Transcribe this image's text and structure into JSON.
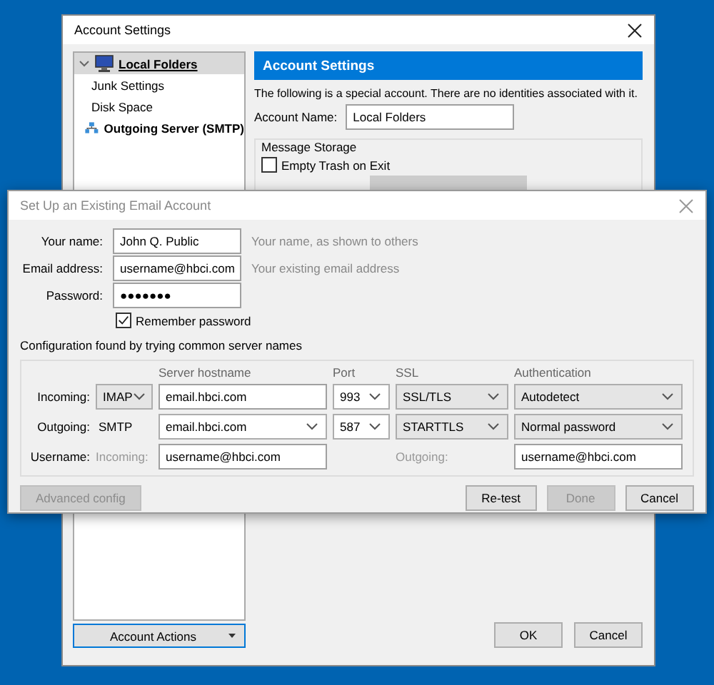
{
  "account_settings_window": {
    "title": "Account Settings",
    "tree": [
      {
        "label": "Local Folders",
        "selected": true,
        "expanded": true,
        "children": [
          {
            "label": "Junk Settings",
            "selected": false
          },
          {
            "label": "Disk Space",
            "selected": false
          }
        ]
      },
      {
        "label": "Outgoing Server (SMTP)",
        "selected": false
      }
    ],
    "account_actions_button": "Account Actions",
    "panel": {
      "header": "Account Settings",
      "description": "The following is a special account. There are no identities associated with it.",
      "account_name": {
        "label": "Account Name:",
        "value": "Local Folders"
      },
      "message_storage": {
        "title": "Message Storage",
        "empty_trash": {
          "label": "Empty Trash on Exit",
          "checked": false
        }
      }
    },
    "buttons": [
      {
        "label": "OK"
      },
      {
        "label": "Cancel"
      }
    ]
  },
  "setup_dialog": {
    "title": "Set Up an Existing Email Account",
    "fields": [
      {
        "label": "Your name:",
        "value": "John Q. Public",
        "hint": "Your name, as shown to others"
      },
      {
        "label": "Email address:",
        "value": "username@hbci.com",
        "hint": "Your existing email address"
      },
      {
        "label": "Password:",
        "value": "●●●●●●●"
      }
    ],
    "remember_password": {
      "label": "Remember password",
      "checked": true
    },
    "status": "Configuration found by trying common server names",
    "server_columns": [
      "Server hostname",
      "Port",
      "SSL",
      "Authentication"
    ],
    "server_rows": [
      {
        "label": "Incoming:",
        "protocol": {
          "kind": "dropdown",
          "value": "IMAP"
        },
        "hostname": {
          "kind": "field",
          "value": "email.hbci.com"
        },
        "port": "993",
        "ssl": "SSL/TLS",
        "authentication": "Autodetect"
      },
      {
        "label": "Outgoing:",
        "protocol": {
          "kind": "text",
          "value": "SMTP"
        },
        "hostname": {
          "kind": "combo",
          "value": "email.hbci.com"
        },
        "port": "587",
        "ssl": "STARTTLS",
        "authentication": "Normal password"
      }
    ],
    "username_row": {
      "label": "Username:",
      "incoming_label": "Incoming:",
      "incoming_value": "username@hbci.com",
      "outgoing_label": "Outgoing:",
      "outgoing_value": "username@hbci.com"
    },
    "buttons": [
      {
        "label": "Advanced config",
        "disabled": true
      },
      {
        "label": "Re-test",
        "disabled": false
      },
      {
        "label": "Done",
        "disabled": true
      },
      {
        "label": "Cancel",
        "disabled": false
      }
    ]
  }
}
